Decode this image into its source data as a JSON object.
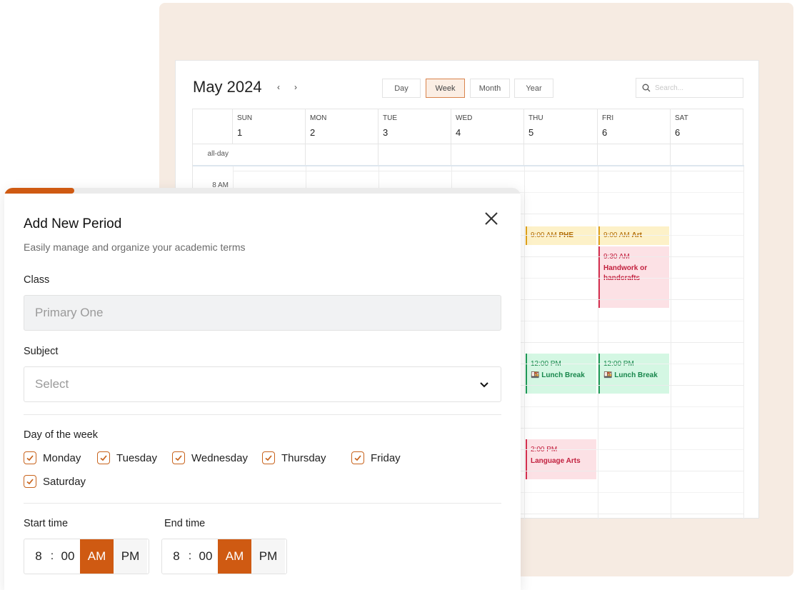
{
  "calendar": {
    "title": "May 2024",
    "prev_label": "‹",
    "next_label": "›",
    "views": [
      "Day",
      "Week",
      "Month",
      "Year"
    ],
    "active_view": "Week",
    "search_placeholder": "Search...",
    "days": [
      {
        "name": "SUN",
        "date": "1"
      },
      {
        "name": "MON",
        "date": "2"
      },
      {
        "name": "TUE",
        "date": "3"
      },
      {
        "name": "WED",
        "date": "4"
      },
      {
        "name": "THU",
        "date": "5"
      },
      {
        "name": "FRI",
        "date": "6"
      },
      {
        "name": "SAT",
        "date": "6"
      }
    ],
    "allday_label": "all-day",
    "time_label_8am": "8 AM",
    "events": [
      {
        "day": "THU",
        "time": "9:00 AM",
        "name": "PHE",
        "color": "yellow"
      },
      {
        "day": "FRI",
        "time": "9:00 AM",
        "name": "Art",
        "color": "yellow"
      },
      {
        "day": "FRI",
        "time": "9:30 AM",
        "name": "Handwork or handcrafts",
        "color": "pink"
      },
      {
        "day": "THU",
        "time": "12:00 PM",
        "name": "🍱 Lunch Break",
        "color": "green"
      },
      {
        "day": "FRI",
        "time": "12:00 PM",
        "name": "🍱 Lunch Break",
        "color": "green"
      },
      {
        "day": "THU",
        "time": "2:00 PM",
        "name": "Language Arts",
        "color": "pink"
      }
    ]
  },
  "modal": {
    "title": "Add New Period",
    "subtitle": "Easily manage and organize your academic terms",
    "close_icon": "close-icon",
    "progress": 0.135,
    "class_label": "Class",
    "class_placeholder": "Primary One",
    "subject_label": "Subject",
    "subject_placeholder": "Select",
    "days_label": "Day of the week",
    "days": [
      {
        "label": "Monday",
        "checked": true
      },
      {
        "label": "Tuesday",
        "checked": true
      },
      {
        "label": "Wednesday",
        "checked": true
      },
      {
        "label": "Thursday",
        "checked": true
      },
      {
        "label": "Friday",
        "checked": true
      },
      {
        "label": "Saturday",
        "checked": true
      }
    ],
    "start_time": {
      "label": "Start time",
      "hour": "8",
      "sep": ":",
      "minute": "00",
      "am": "AM",
      "pm": "PM",
      "selected": "AM"
    },
    "end_time": {
      "label": "End time",
      "hour": "8",
      "sep": ":",
      "minute": "00",
      "am": "AM",
      "pm": "PM",
      "selected": "AM"
    }
  },
  "colors": {
    "accent": "#cf5a12",
    "background_card": "#f6ebe2"
  }
}
